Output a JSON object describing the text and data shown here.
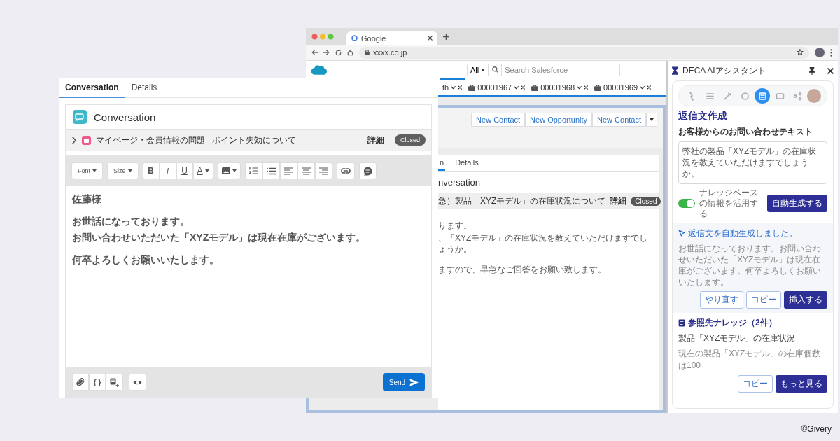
{
  "browser": {
    "tab_title": "Google",
    "url": "xxxx.co.jp",
    "search_scope": "All",
    "search_placeholder": "Search Salesforce",
    "workspace_tabs": [
      {
        "label": "th",
        "selected": true
      },
      {
        "label": "00001967",
        "selected": false
      },
      {
        "label": "00001968",
        "selected": false
      },
      {
        "label": "00001969",
        "selected": false
      }
    ],
    "actions": [
      "New Contact",
      "New Opportunity",
      "New Contact"
    ],
    "record_tabs": [
      {
        "label": "n",
        "selected": true
      },
      {
        "label": "Details",
        "selected": false
      }
    ],
    "record_title": "nversation",
    "record_subject": "急）製品「XYZモデル」の在庫状況について",
    "record_detail_link": "詳細",
    "record_status": "Closed",
    "record_body": [
      [
        "ります。",
        "、「XYZモデル」の在庫状況を教えていただけますでしょうか。"
      ],
      [
        "ますので、早急なご回答をお願い致します。"
      ]
    ]
  },
  "assistant": {
    "title": "DECA AIアシスタント",
    "tools": [
      {
        "selected": false
      },
      {
        "selected": false
      },
      {
        "selected": false
      },
      {
        "selected": false
      },
      {
        "selected": true
      },
      {
        "selected": false
      },
      {
        "selected": false
      }
    ],
    "heading": "返信文作成",
    "input_label": "お客様からのお問い合わせテキスト",
    "input_text": "弊社の製品「XYZモデル」の在庫状況を教えていただけますでしょうか。",
    "knowledge_toggle": {
      "label": "ナレッジベースの情報を活用する",
      "on": true
    },
    "generate_button": "自動生成する",
    "result_heading": "返信文を自動生成しました。",
    "result_text": "お世話になっております。お問い合わせいただいた「XYZモデル」は現在在庫がございます。何卒よろしくお願いいたします。",
    "result_buttons": [
      {
        "label": "やり直す",
        "kind": "outline"
      },
      {
        "label": "コピー",
        "kind": "outline"
      },
      {
        "label": "挿入する",
        "kind": "primary"
      }
    ],
    "knowledge_heading": "参照先ナレッジ（2件）",
    "knowledge_title": "製品「XYZモデル」の在庫状況",
    "knowledge_snippet": "現在の製品「XYZモデル」の在庫個数は100",
    "knowledge_buttons": [
      {
        "label": "コピー",
        "kind": "outline"
      },
      {
        "label": "もっと見る",
        "kind": "primary"
      }
    ]
  },
  "front_panel": {
    "tabs": [
      {
        "label": "Conversation",
        "selected": true
      },
      {
        "label": "Details",
        "selected": false
      }
    ],
    "card_title": "Conversation",
    "case": {
      "expanded": false,
      "subject": "マイページ・会員情報の問題 - ポイント失効について",
      "detail_link": "詳細",
      "status": "Closed"
    },
    "font_menu": "Font",
    "size_menu": "Size",
    "format_buttons": [
      {
        "label": "B",
        "kind": "bold"
      },
      {
        "label": "I",
        "kind": "italic"
      },
      {
        "label": "U",
        "kind": "underline"
      },
      {
        "label": "A",
        "kind": "color"
      }
    ],
    "body": [
      [
        "佐藤様"
      ],
      [
        "お世話になっております。",
        "お問い合わせいただいた「XYZモデル」は現在在庫がございます。"
      ],
      [
        "何卒よろしくお願いいたします。"
      ]
    ],
    "merge_button": "{ }",
    "send_button": "Send"
  },
  "copyright": "©Givery"
}
